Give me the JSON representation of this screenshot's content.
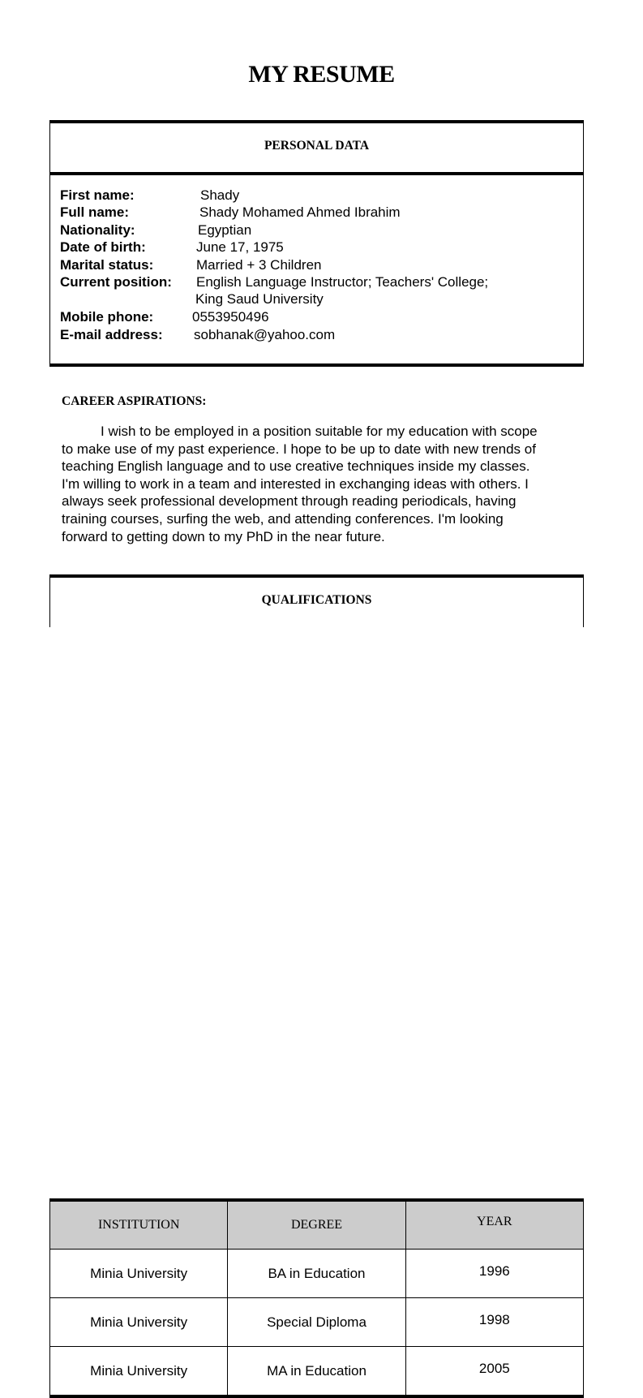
{
  "title": "MY RESUME",
  "personal": {
    "heading": "PERSONAL DATA",
    "fields": [
      {
        "label": "First name:",
        "value": "Shady"
      },
      {
        "label": "Full name:",
        "value": "Shady Mohamed Ahmed Ibrahim"
      },
      {
        "label": "Nationality:",
        "value": "Egyptian"
      },
      {
        "label": "Date of birth:",
        "value": "June 17, 1975"
      },
      {
        "label": "Marital status:",
        "value": "Married + 3 Children"
      },
      {
        "label": "Current position:",
        "value": "English Language Instructor; Teachers' College;",
        "value2": "King Saud University"
      },
      {
        "label": "Mobile phone:",
        "value": "0553950496"
      },
      {
        "label": "E-mail address:",
        "value": "sobhanak@yahoo.com"
      }
    ]
  },
  "career": {
    "heading": "CAREER ASPIRATIONS:",
    "lines": [
      "I wish to be employed in a position suitable for my education with scope",
      "to make use of my past experience. I hope to be up to date with new trends of",
      "teaching English language and to use creative techniques inside my classes.",
      "I'm willing to work in a team and interested in exchanging ideas with others. I",
      "always seek professional development through reading periodicals, having",
      "training courses, surfing the web, and attending conferences.  I'm looking",
      "forward to getting down to my PhD in the near future."
    ]
  },
  "qualifications": {
    "heading": "QUALIFICATIONS",
    "columns": [
      "INSTITUTION",
      "DEGREE",
      "YEAR"
    ],
    "rows": [
      {
        "institution": "Minia University",
        "degree": "BA in Education",
        "year": "1996"
      },
      {
        "institution": "Minia University",
        "degree": "Special Diploma",
        "year": "1998"
      },
      {
        "institution": "Minia University",
        "degree": "MA in Education",
        "year": "2005"
      }
    ]
  }
}
